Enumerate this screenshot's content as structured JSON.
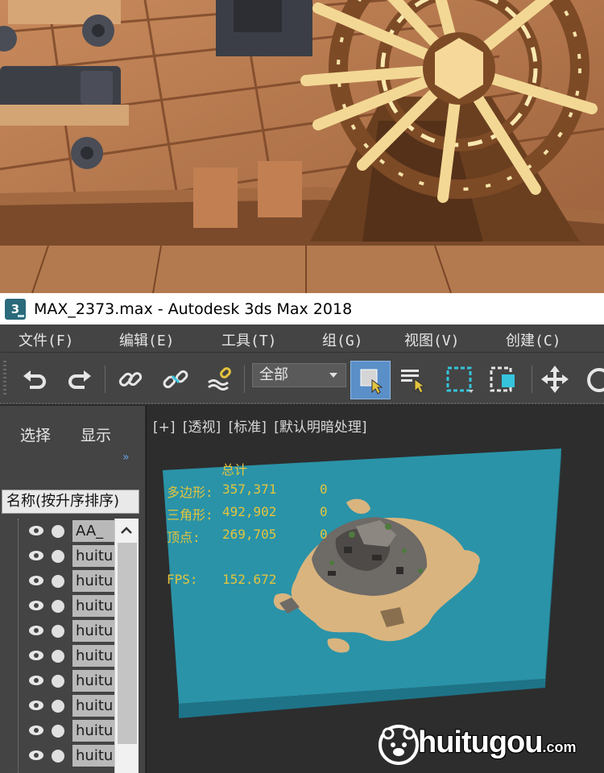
{
  "window": {
    "title": "MAX_2373.max - Autodesk 3ds Max 2018",
    "app_icon_glyph": "3"
  },
  "menu": {
    "items": [
      {
        "label": "文件(F)"
      },
      {
        "label": "编辑(E)"
      },
      {
        "label": "工具(T)"
      },
      {
        "label": "组(G)"
      },
      {
        "label": "视图(V)"
      },
      {
        "label": "创建(C)"
      }
    ]
  },
  "toolbar": {
    "selection_filter": "全部",
    "icons": [
      "undo-icon",
      "redo-icon",
      "link-icon",
      "unlink-icon",
      "bind-spacewarp-icon",
      "select-object-icon",
      "select-by-name-icon",
      "rectangular-selection-icon",
      "window-crossing-icon",
      "move-icon",
      "rotate-icon"
    ],
    "active_color": "#5b8fc7",
    "accent_cyan": "#35c4dc"
  },
  "explorer": {
    "tab_select": "选择",
    "tab_display": "显示",
    "more_glyph": "»",
    "column_header": "名称(按升序排序)",
    "rows": [
      {
        "name": "AA_"
      },
      {
        "name": "huitu"
      },
      {
        "name": "huitu"
      },
      {
        "name": "huitu"
      },
      {
        "name": "huitu"
      },
      {
        "name": "huitu"
      },
      {
        "name": "huitu"
      },
      {
        "name": "huitu"
      },
      {
        "name": "huitu"
      },
      {
        "name": "huitu"
      }
    ]
  },
  "viewport": {
    "labels": [
      "[+]",
      "[透视]",
      "[标准]",
      "[默认明暗处理]"
    ],
    "stats": {
      "header": "总计",
      "rows": [
        {
          "label": "多边形:",
          "total": "357,371",
          "selected": "0"
        },
        {
          "label": "三角形:",
          "total": "492,902",
          "selected": "0"
        },
        {
          "label": "顶点:",
          "total": "269,705",
          "selected": "0"
        }
      ],
      "fps_label": "FPS:",
      "fps_value": "152.672",
      "color": "#e3c43e"
    },
    "water_color": "#2a93a8"
  },
  "watermark": {
    "brand": "huitugou",
    "domain": ".com"
  }
}
